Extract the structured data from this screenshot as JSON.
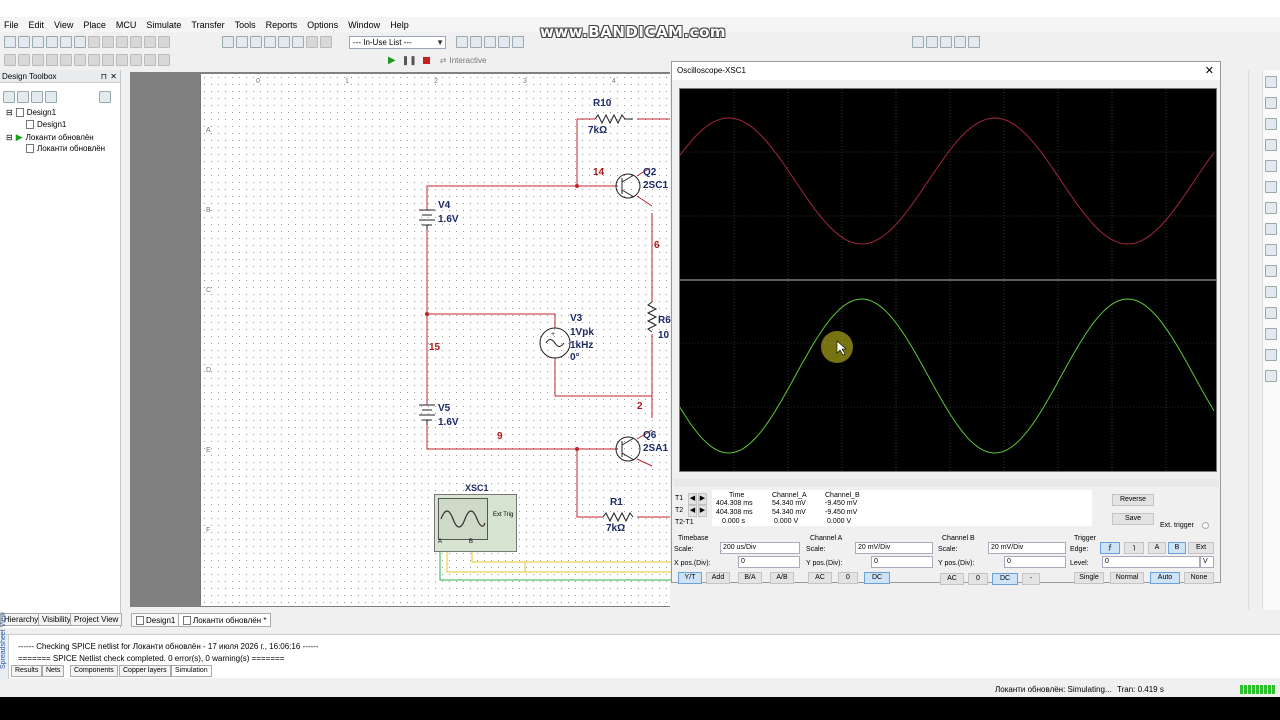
{
  "menu": [
    "File",
    "Edit",
    "View",
    "Place",
    "MCU",
    "Simulate",
    "Transfer",
    "Tools",
    "Reports",
    "Options",
    "Window",
    "Help"
  ],
  "toolbar": {
    "in_use_list": "--- In-Use List ---",
    "interactive": "Interactive"
  },
  "watermark": "www.BANDICAM.com",
  "toolbox": {
    "title": "Design Toolbox",
    "items": [
      "Design1",
      "Design1",
      "Локанти обновлён",
      "Локанти обновлён"
    ],
    "tabs": [
      "Hierarchy",
      "Visibility",
      "Project View"
    ]
  },
  "ruler": {
    "top": [
      "0",
      "1",
      "2",
      "3",
      "4",
      "5"
    ],
    "left": [
      "A",
      "B",
      "C",
      "D",
      "E",
      "F"
    ]
  },
  "schematic": {
    "components": [
      {
        "ref": "R10",
        "value": "7kΩ"
      },
      {
        "ref": "Q2",
        "value": "2SC1"
      },
      {
        "ref": "V4",
        "value": "1.6V"
      },
      {
        "ref": "V3",
        "value": "1Vpk",
        "value2": "1kHz",
        "value3": "0°"
      },
      {
        "ref": "R6",
        "value": "10"
      },
      {
        "ref": "V5",
        "value": "1.6V"
      },
      {
        "ref": "Q6",
        "value": "2SA1"
      },
      {
        "ref": "R1",
        "value": "7kΩ"
      },
      {
        "ref": "XSC1",
        "value": "Ext Trig"
      }
    ],
    "nets": [
      "14",
      "6",
      "15",
      "2",
      "9"
    ],
    "scope_ports": [
      "A",
      "B"
    ]
  },
  "doc_tabs": [
    "Design1",
    "Локанти обновлён *"
  ],
  "oscilloscope": {
    "title": "Oscilloscope-XSC1",
    "readout": {
      "headers": [
        "Time",
        "Channel_A",
        "Channel_B"
      ],
      "rows": [
        {
          "label": "T1",
          "time": "404.308 ms",
          "a": "54.340 mV",
          "b": "-9.450 mV"
        },
        {
          "label": "T2",
          "time": "404.308 ms",
          "a": "54.340 mV",
          "b": "-9.450 mV"
        },
        {
          "label": "T2-T1",
          "time": "0.000 s",
          "a": "0.000 V",
          "b": "0.000 V"
        }
      ]
    },
    "buttons": {
      "reverse": "Reverse",
      "save": "Save",
      "ext_trigger": "Ext. trigger"
    },
    "timebase": {
      "title": "Timebase",
      "scale_label": "Scale:",
      "scale": "200 us/Div",
      "xpos_label": "X pos.(Div):",
      "xpos": "0",
      "modes": [
        "Y/T",
        "Add",
        "B/A",
        "A/B"
      ]
    },
    "channel_a": {
      "title": "Channel A",
      "scale_label": "Scale:",
      "scale": "20 mV/Div",
      "ypos_label": "Y pos.(Div):",
      "ypos": "0",
      "coupling": [
        "AC",
        "0",
        "DC"
      ]
    },
    "channel_b": {
      "title": "Channel B",
      "scale_label": "Scale:",
      "scale": "20 mV/Div",
      "ypos_label": "Y pos.(Div):",
      "ypos": "0",
      "coupling": [
        "AC",
        "0",
        "DC",
        "-"
      ]
    },
    "trigger": {
      "title": "Trigger",
      "edge_label": "Edge:",
      "edge_buttons": [
        "A",
        "B",
        "Ext"
      ],
      "level_label": "Level:",
      "level": "0",
      "level_unit": "V",
      "modes": [
        "Single",
        "Normal",
        "Auto",
        "None"
      ]
    },
    "trace_colors": {
      "channel_a": "#a3283a",
      "channel_b": "#5fc832"
    }
  },
  "log": {
    "line1": "------ Checking SPICE netlist for Локанти обновлён - 17 июля 2026 г., 16:06:16 ------",
    "line2": "======= SPICE Netlist check completed. 0 error(s), 0 warning(s) =======",
    "tabs": [
      "Results",
      "Nets",
      "Components",
      "Copper layers",
      "Simulation"
    ],
    "side_label": "Spreadsheet View"
  },
  "status": {
    "text": "Локанти обновлён: Simulating...",
    "tran": "Tran: 0.419 s"
  }
}
